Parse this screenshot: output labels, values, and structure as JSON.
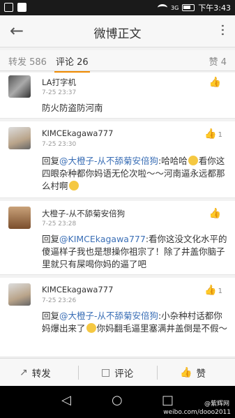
{
  "status_bar": {
    "signal_text": "3G",
    "time": "下午3:43",
    "colors": {
      "background": "#1a1a1a"
    }
  },
  "nav": {
    "back_icon": "back-arrow-icon",
    "title": "微博正文",
    "more_icon": "more-dots-icon"
  },
  "tabs": {
    "repost": "转发 586",
    "comments": "评论 26",
    "likes": "赞 4",
    "accent": "#f08a00"
  },
  "comments": [
    {
      "name": "LA打字机",
      "time": "7-25 23:37",
      "likes": "",
      "text": "防火防盗防河南"
    },
    {
      "name": "KIMCEkagawa777",
      "time": "7-25 23:30",
      "likes": "1",
      "prefix": "回复",
      "mention": "@大橙子-从不舔菊安倍狗",
      "text_a": ":哈哈哈",
      "text_b": "看你这四眼杂种都你妈语无伦次啦～～河南逼永远都那么村啊"
    },
    {
      "name": "大橙子-从不舔菊安倍狗",
      "time": "7-25 23:28",
      "likes": "",
      "prefix": "回复",
      "mention": "@KIMCEkagawa777",
      "text": ":看你这没文化水平的傻逼样子我也是想操你祖宗了！除了井盖你脑子里就只有屎喝你妈的逼了吧"
    },
    {
      "name": "KIMCEkagawa777",
      "time": "7-25 23:26",
      "likes": "1",
      "prefix": "回复",
      "mention": "@大橙子-从不舔菊安倍狗",
      "text_a": ":小杂种村话都你妈爆出来了",
      "text_b": "你妈翻毛逼里塞满井盖倒是不假～"
    }
  ],
  "actions": {
    "repost": "转发",
    "comment": "评论",
    "like": "赞"
  },
  "watermark": {
    "line1": "@紫辉网",
    "line2": "weibo.com/dooo2011"
  }
}
